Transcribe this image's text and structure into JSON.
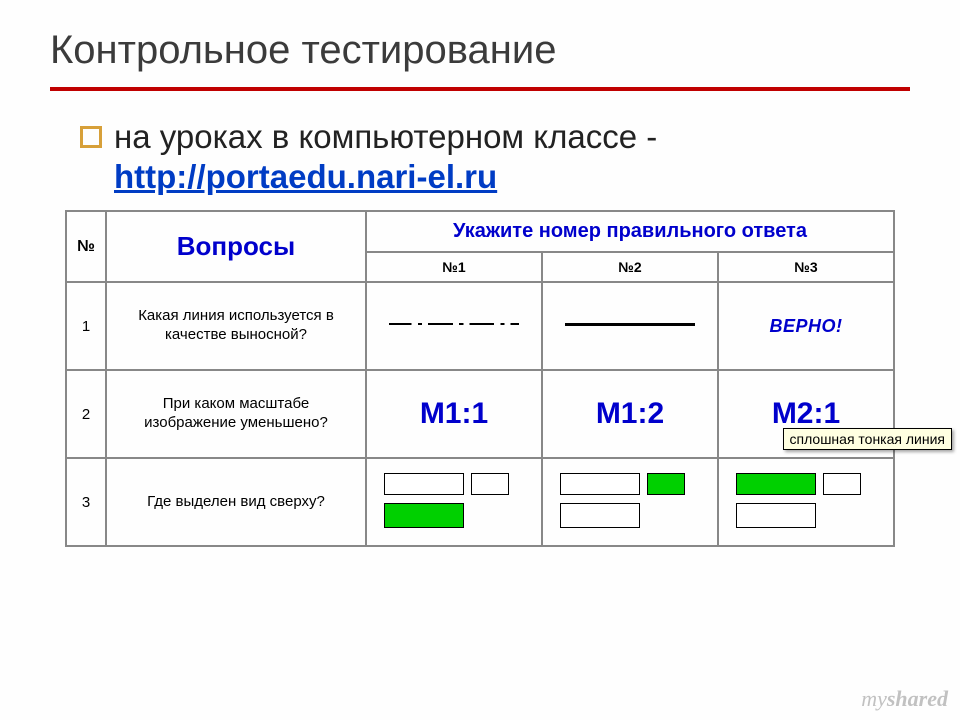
{
  "title": "Контрольное тестирование",
  "bullet": {
    "lead": "на уроках в компьютерном классе -",
    "link_text": "http://portaedu.nari-el.ru"
  },
  "table": {
    "col_num": "№",
    "questions_header": "Вопросы",
    "instruction": "Укажите номер правильного ответа",
    "answer_labels": [
      "№1",
      "№2",
      "№3"
    ],
    "rows": [
      {
        "n": "1",
        "question": "Какая линия используется в качестве выносной?",
        "ans3_text": "ВЕРНО!"
      },
      {
        "n": "2",
        "question": "При каком масштабе изображение уменьшено?",
        "answers": [
          "М1:1",
          "М1:2",
          "М2:1"
        ]
      },
      {
        "n": "3",
        "question": "Где выделен вид сверху?"
      }
    ]
  },
  "tooltip": "сплошная тонкая линия",
  "watermark_plain": "my",
  "watermark_bold": "shared"
}
